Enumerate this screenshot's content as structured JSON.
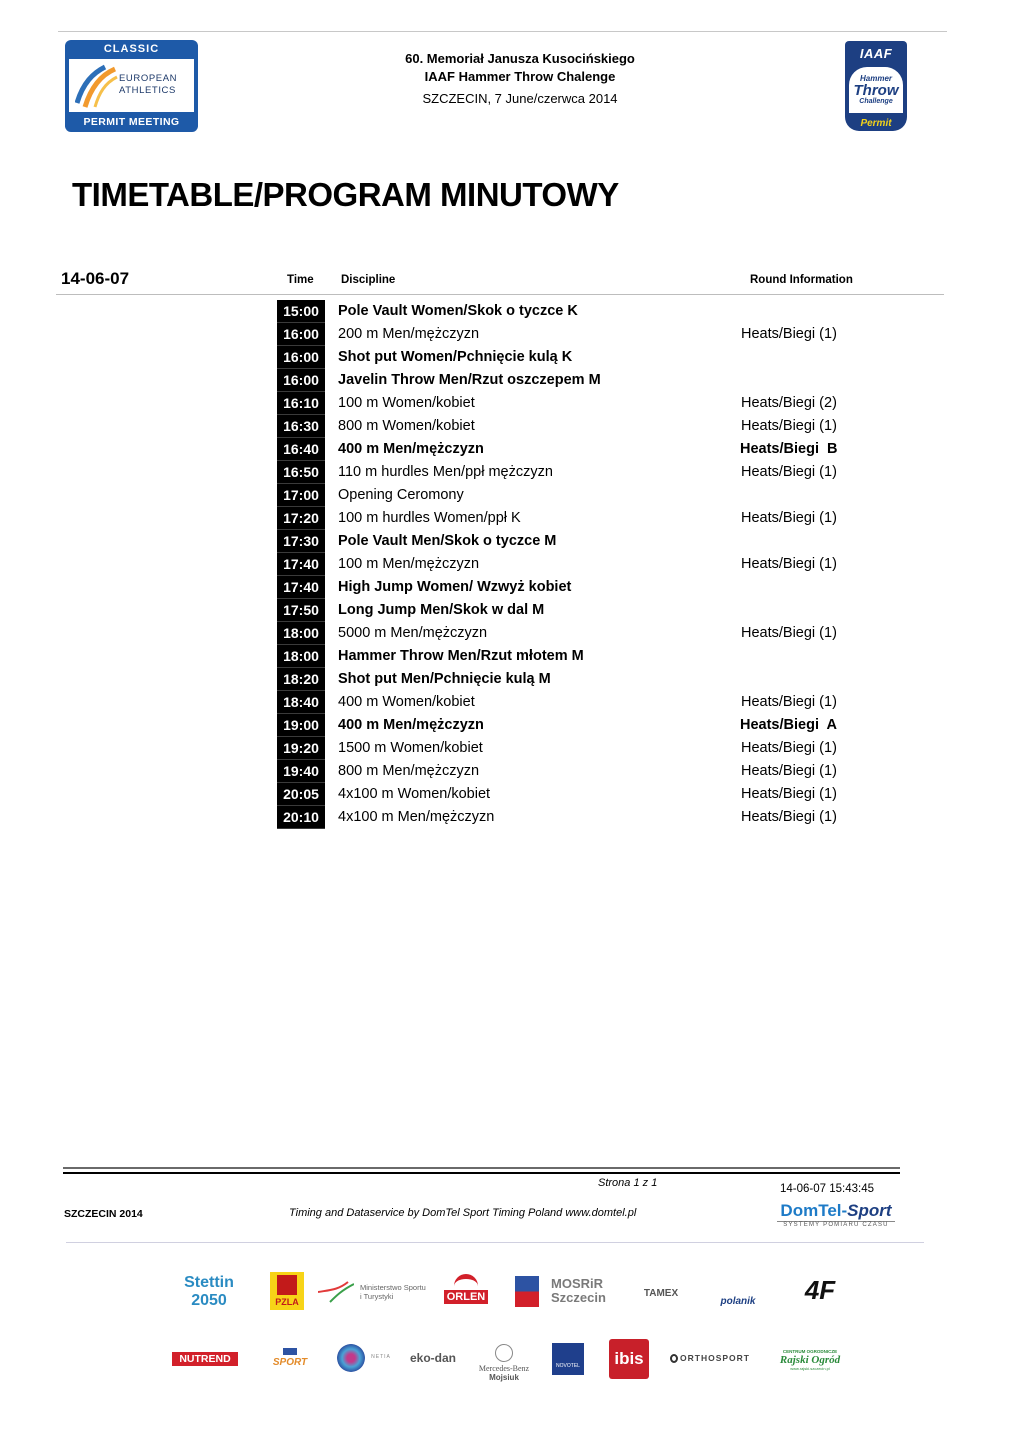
{
  "header": {
    "line1": "60. Memoriał Janusza Kusocińskiego",
    "line2": "IAAF Hammer Throw Chalenge",
    "line3": "SZCZECIN, 7 June/czerwca 2014"
  },
  "logos": {
    "left": {
      "top": "CLASSIC",
      "mid1": "EUROPEAN",
      "mid2": "ATHLETICS",
      "bottom": "PERMIT MEETING"
    },
    "right": {
      "top": "IAAF",
      "w1": "Hammer",
      "w2": "Throw",
      "w3": "Challenge",
      "bottom": "Permit"
    }
  },
  "title": "TIMETABLE/PROGRAM MINUTOWY",
  "table": {
    "date": "14-06-07",
    "columns": {
      "time": "Time",
      "discipline": "Discipline",
      "round": "Round Information"
    },
    "rows": [
      {
        "time": "15:00",
        "discipline": "Pole Vault Women/Skok o tyczce K",
        "round": "",
        "bold": true
      },
      {
        "time": "16:00",
        "discipline": "200 m Men/mężczyzn",
        "round": "Heats/Biegi (1)",
        "bold": false
      },
      {
        "time": "16:00",
        "discipline": "Shot put Women/Pchnięcie kulą K",
        "round": "",
        "bold": true
      },
      {
        "time": "16:00",
        "discipline": "Javelin Throw Men/Rzut oszczepem M",
        "round": "",
        "bold": true
      },
      {
        "time": "16:10",
        "discipline": "100 m Women/kobiet",
        "round": "Heats/Biegi (2)",
        "bold": false
      },
      {
        "time": "16:30",
        "discipline": "800 m Women/kobiet",
        "round": "Heats/Biegi (1)",
        "bold": false
      },
      {
        "time": "16:40",
        "discipline": "400 m Men/mężczyzn",
        "round": "Heats/Biegi  B",
        "bold": true
      },
      {
        "time": "16:50",
        "discipline": "110 m hurdles Men/ppł mężczyzn",
        "round": "Heats/Biegi (1)",
        "bold": false
      },
      {
        "time": "17:00",
        "discipline": "Opening Ceromony",
        "round": "",
        "bold": false
      },
      {
        "time": "17:20",
        "discipline": "100 m hurdles Women/ppł K",
        "round": "Heats/Biegi (1)",
        "bold": false
      },
      {
        "time": "17:30",
        "discipline": "Pole Vault Men/Skok o tyczce M",
        "round": "",
        "bold": true
      },
      {
        "time": "17:40",
        "discipline": "100 m Men/mężczyzn",
        "round": "Heats/Biegi (1)",
        "bold": false
      },
      {
        "time": "17:40",
        "discipline": "High Jump Women/ Wzwyż kobiet",
        "round": "",
        "bold": true
      },
      {
        "time": "17:50",
        "discipline": "Long Jump Men/Skok w dal M",
        "round": "",
        "bold": true
      },
      {
        "time": "18:00",
        "discipline": "5000 m Men/mężczyzn",
        "round": "Heats/Biegi (1)",
        "bold": false
      },
      {
        "time": "18:00",
        "discipline": "Hammer Throw Men/Rzut młotem M",
        "round": "",
        "bold": true
      },
      {
        "time": "18:20",
        "discipline": "Shot put Men/Pchnięcie kulą M",
        "round": "",
        "bold": true
      },
      {
        "time": "18:40",
        "discipline": "400 m Women/kobiet",
        "round": "Heats/Biegi (1)",
        "bold": false
      },
      {
        "time": "19:00",
        "discipline": "400 m Men/mężczyzn",
        "round": "Heats/Biegi  A",
        "bold": true
      },
      {
        "time": "19:20",
        "discipline": "1500 m Women/kobiet",
        "round": "Heats/Biegi (1)",
        "bold": false
      },
      {
        "time": "19:40",
        "discipline": "800 m Men/mężczyzn",
        "round": "Heats/Biegi (1)",
        "bold": false
      },
      {
        "time": "20:05",
        "discipline": "4x100 m Women/kobiet",
        "round": "Heats/Biegi (1)",
        "bold": false
      },
      {
        "time": "20:10",
        "discipline": "4x100 m Men/mężczyzn",
        "round": "Heats/Biegi (1)",
        "bold": false
      }
    ]
  },
  "footer": {
    "page": "Strona 1 z 1",
    "printed": "14-06-07 15:43:45",
    "left": "SZCZECIN 2014",
    "timing": "Timing and Dataservice by DomTel Sport Timing  Poland www.domtel.pl",
    "domtel": {
      "name1": "DomTel-",
      "name2": "Sport",
      "tagline": "SYSTEMY POMIARU CZASU"
    }
  },
  "sponsors": {
    "stettin": "Stettin 2050",
    "pzla": "PZLA",
    "ministry": "Ministerstwo Sportu i Turystyki",
    "orlen": "ORLEN",
    "mosrir": "MOSRiR Szczecin",
    "tamex": "TAMEX",
    "polanik": "polanik",
    "fourf": "4F",
    "nutrend": "NUTREND",
    "tvp": "SPORT",
    "netia": "NETIA",
    "ekodan": "eko-dan",
    "merc1": "Mercedes-Benz",
    "merc2": "Mojsiuk",
    "novotel": "NOVOTEL",
    "ibis": "ibis",
    "ortho": "ORTHOSPORT",
    "rajski1": "CENTRUM OGRODNICZE",
    "rajski2": "Rajski Ogród",
    "rajski3": "www.rajski.szczecin.pl"
  }
}
